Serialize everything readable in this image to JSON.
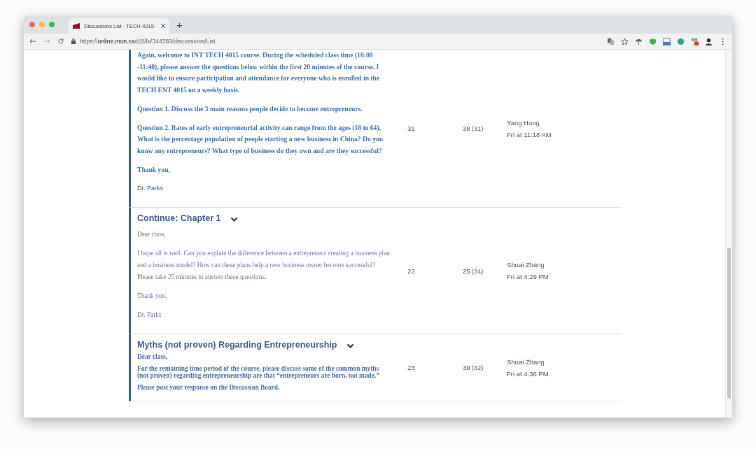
{
  "browser": {
    "tab": {
      "title": "Discussions List - TECH-4015-",
      "selected": true
    },
    "new_tab": "+",
    "url": "https://**online.mun.ca**/d2l/le/344383/discussions/List"
  },
  "topics": [
    {
      "kind": "bold",
      "paragraphs": [
        {
          "kind": "text",
          "text": "Again, welcome to INT TECH 4015 course. During the scheduled class time (10:00 -11:40), please answer the questions below within the first 20 minutes of the course. I would like to ensure participation and attendance for everyone who is enrolled in the TECH ENT 4015 on a weekly basis."
        },
        {
          "kind": "text",
          "text": "Question 1. Discuss the 3 main reasons people decide to become entrepreneurs."
        },
        {
          "kind": "text",
          "text": "Question 2. Rates of early entrepreneurial activity can range from the ages (18 to 64). What is the percentage population of people starting a new business in China? Do you know any entrepreneurs? What type of business do they own and are they successful?"
        },
        {
          "kind": "text",
          "text": "Thank you,"
        },
        {
          "kind": "signature",
          "text": "Dr. Parks"
        }
      ],
      "threads": "31",
      "posts": "38",
      "unread": "(31)",
      "last_author": "Yang Hong",
      "last_time": "Fri at 11:18 AM"
    },
    {
      "title": "Continue: Chapter 1",
      "kind": "plain",
      "paragraphs": [
        {
          "kind": "text",
          "text": "Dear class,"
        },
        {
          "kind": "text",
          "text": "I hope all is well. Can you explain the difference between a entrepreneur creating a business plan and a business model? How can these plans help a new business owner become successful? Please take 25 minutes to answer these questions."
        },
        {
          "kind": "text",
          "text": "Thank you,"
        },
        {
          "kind": "text",
          "text": "Dr. Parks"
        }
      ],
      "threads": "23",
      "posts": "25",
      "unread": "(24)",
      "last_author": "Shuai Zhang",
      "last_time": "Fri at 4:29 PM"
    },
    {
      "title": "Myths (not proven) Regarding Entrepreneurship",
      "kind": "compact",
      "paragraphs": [
        {
          "kind": "text",
          "text": "Dear class,"
        },
        {
          "kind": "text",
          "text": "For the remaining time period of the course, please discuss some of the common myths (not proven) regarding entrepreneurship are that “entrepreneurs are born, not made.”"
        },
        {
          "kind": "text",
          "text": "Please post your response on the Discussion Board."
        }
      ],
      "threads": "23",
      "posts": "39",
      "unread": "(32)",
      "last_author": "Shuai Zhang",
      "last_time": "Fri at 4:36 PM"
    }
  ]
}
